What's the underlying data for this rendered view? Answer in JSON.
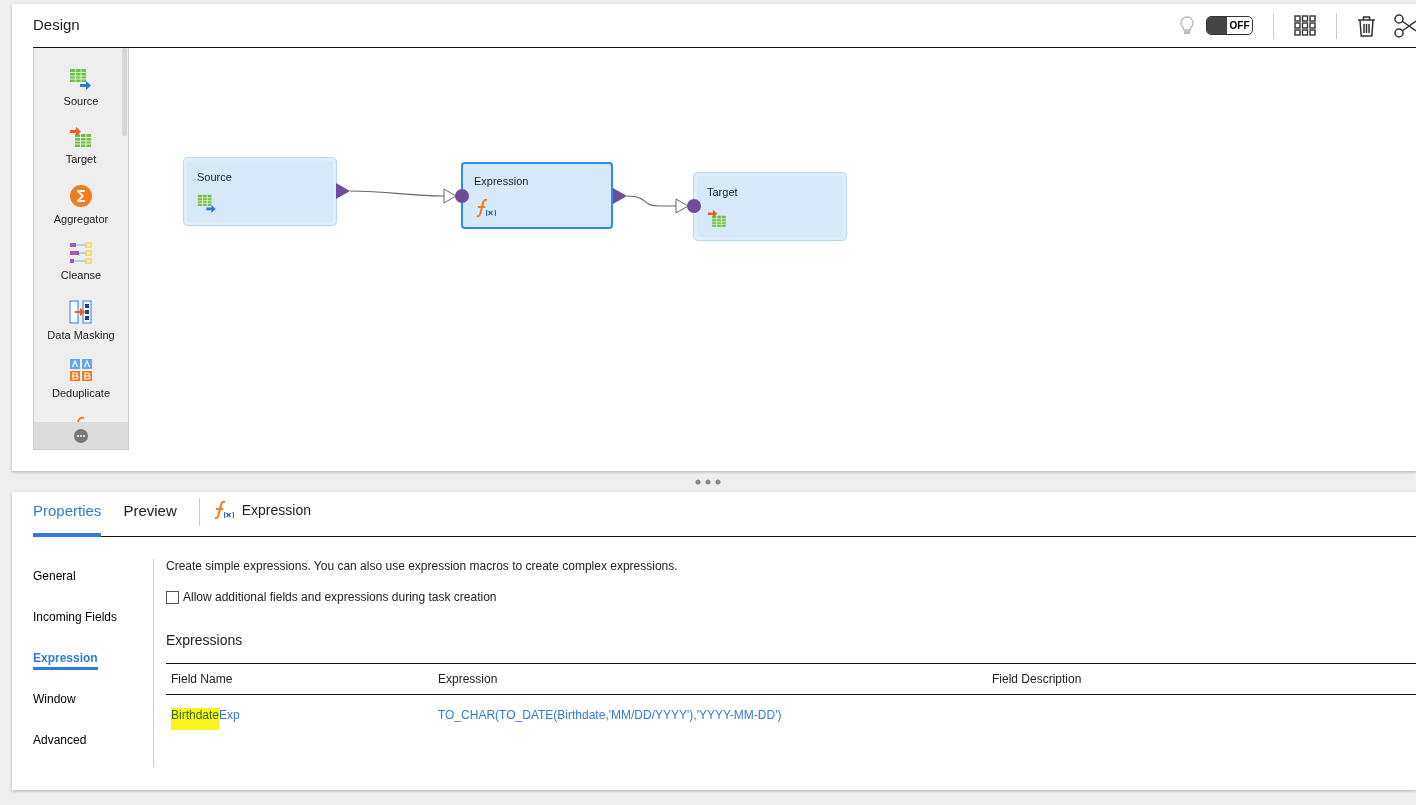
{
  "design_panel": {
    "title": "Design",
    "toolbar": {
      "tips_toggle": {
        "label": "OFF",
        "on": false
      }
    }
  },
  "palette": {
    "items": [
      {
        "kind": "source",
        "label": "Source"
      },
      {
        "kind": "target",
        "label": "Target"
      },
      {
        "kind": "aggregator",
        "label": "Aggregator"
      },
      {
        "kind": "cleanse",
        "label": "Cleanse"
      },
      {
        "kind": "masking",
        "label": "Data Masking"
      },
      {
        "kind": "deduplicate",
        "label": "Deduplicate"
      },
      {
        "kind": "expression_partial"
      }
    ]
  },
  "canvas": {
    "nodes": [
      {
        "kind": "source",
        "label": "Source",
        "selected": false
      },
      {
        "kind": "expression",
        "label": "Expression",
        "selected": true
      },
      {
        "kind": "target",
        "label": "Target",
        "selected": false
      }
    ]
  },
  "properties_panel": {
    "tabs": [
      {
        "label": "Properties",
        "selected": true
      },
      {
        "label": "Preview",
        "selected": false
      }
    ],
    "object_title": "Expression",
    "nav": [
      {
        "label": "General",
        "selected": false
      },
      {
        "label": "Incoming Fields",
        "selected": false
      },
      {
        "label": "Expression",
        "selected": true
      },
      {
        "label": "Window",
        "selected": false
      },
      {
        "label": "Advanced",
        "selected": false
      }
    ],
    "description": "Create simple expressions. You can also use expression macros to create complex expressions.",
    "allow_checkbox": {
      "label": "Allow additional fields and expressions during task creation",
      "checked": false
    },
    "section_title": "Expressions",
    "table": {
      "columns": [
        "Field Name",
        "Expression",
        "Field Description"
      ],
      "rows": [
        {
          "field_name_highlighted": "Birthdate",
          "field_name_rest": "Exp",
          "expression": "TO_CHAR(TO_DATE(Birthdate,'MM/DD/YYYY'),'YYYY-MM-DD')"
        }
      ]
    }
  }
}
